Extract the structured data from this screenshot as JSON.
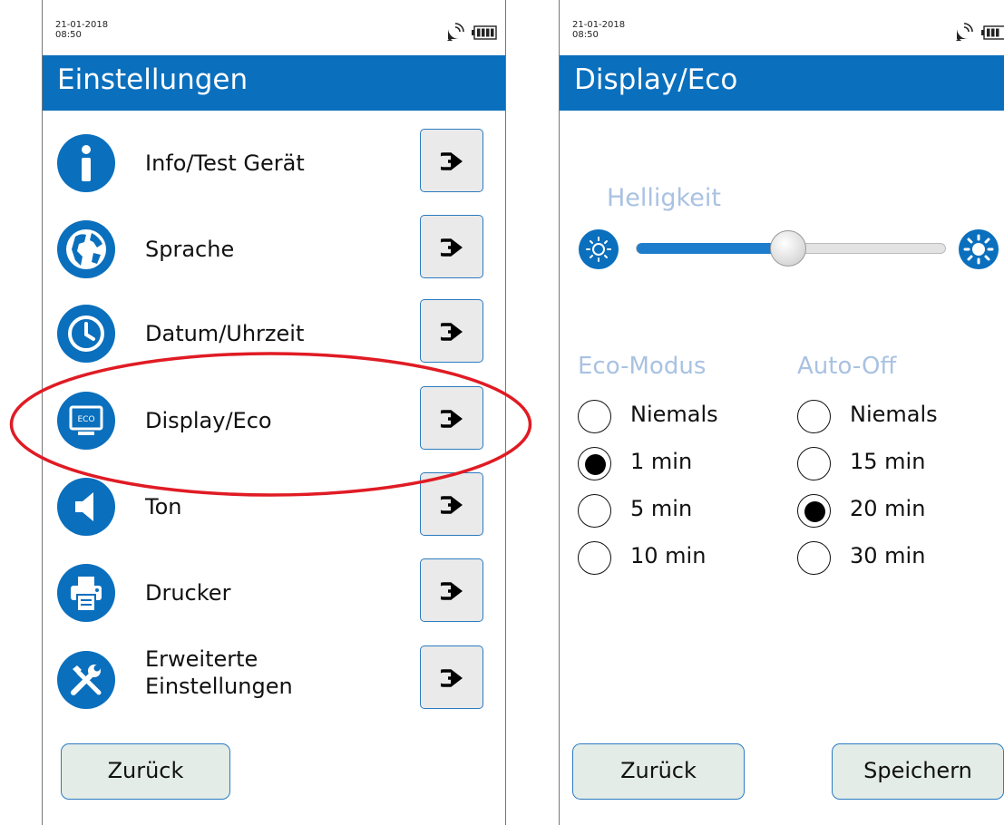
{
  "left": {
    "status": {
      "date": "21-01-2018",
      "time": "08:50"
    },
    "title": "Einstellungen",
    "items": [
      {
        "label": "Info/Test Gerät",
        "icon": "info-icon"
      },
      {
        "label": "Sprache",
        "icon": "globe-icon"
      },
      {
        "label": "Datum/Uhrzeit",
        "icon": "clock-icon"
      },
      {
        "label": "Display/Eco",
        "icon": "eco-monitor-icon",
        "highlighted": true
      },
      {
        "label": "Ton",
        "icon": "speaker-icon"
      },
      {
        "label": "Drucker",
        "icon": "printer-icon"
      },
      {
        "label_line1": "Erweiterte",
        "label_line2": "Einstellungen",
        "icon": "tools-icon"
      }
    ],
    "back_label": "Zurück",
    "highlight_color": "#e01b24"
  },
  "right": {
    "status": {
      "date": "21-01-2018",
      "time": "08:50"
    },
    "title": "Display/Eco",
    "brightness": {
      "label": "Helligkeit",
      "level": 0.49
    },
    "eco_mode": {
      "label": "Eco-Modus",
      "options": [
        "Niemals",
        "1 min",
        "5 min",
        "10 min"
      ],
      "selected": "1 min"
    },
    "auto_off": {
      "label": "Auto-Off",
      "options": [
        "Niemals",
        "15 min",
        "20 min",
        "30 min"
      ],
      "selected": "20 min"
    },
    "back_label": "Zurück",
    "save_label": "Speichern"
  },
  "colors": {
    "accent": "#0a6fbd",
    "label_light": "#a9c2e2",
    "button_bg": "#e3ece6"
  },
  "eco_icon_text": "ECO"
}
